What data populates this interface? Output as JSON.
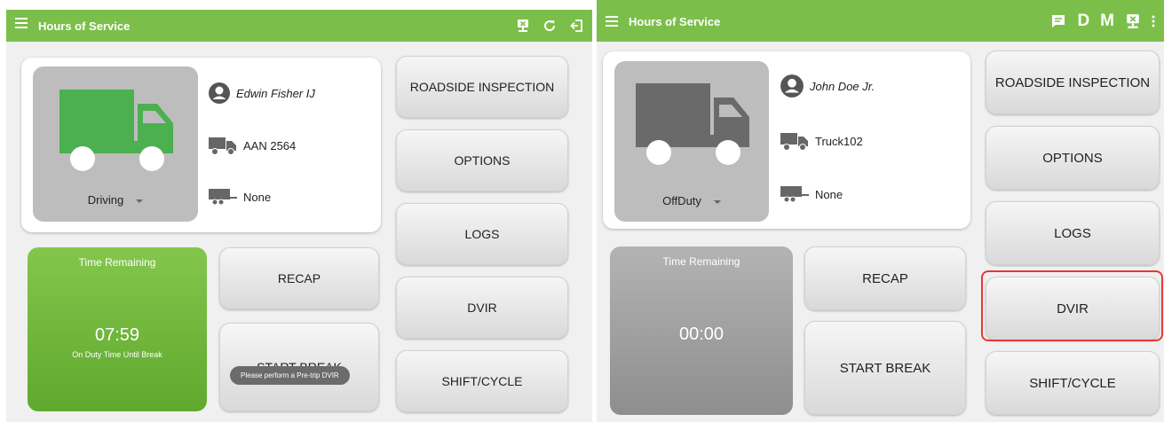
{
  "left": {
    "app_title": "Hours of Service",
    "status": "Driving",
    "driver_name": "Edwin Fisher IJ",
    "vehicle": "AAN 2564",
    "trailer": "None",
    "time_remaining_label": "Time Remaining",
    "time_value": "07:59",
    "time_sub": "On Duty Time Until Break",
    "buttons": {
      "roadside": "ROADSIDE INSPECTION",
      "options": "OPTIONS",
      "logs": "LOGS",
      "dvir": "DVIR",
      "shift": "SHIFT/CYCLE",
      "recap": "RECAP",
      "start_break": "START BREAK"
    },
    "toast": "Please perform a Pre-trip DVIR",
    "icons": [
      "menu-icon",
      "monitor-x-icon",
      "refresh-icon",
      "logout-icon"
    ],
    "colors": {
      "appbar": "#7bbf4a",
      "truck": "#4caf50",
      "timer": "#7cbf43"
    }
  },
  "right": {
    "app_title": "Hours of Service",
    "status": "OffDuty",
    "driver_name": "John Doe Jr.",
    "vehicle": "Truck102",
    "trailer": "None",
    "time_remaining_label": "Time Remaining",
    "time_value": "00:00",
    "toolbar": {
      "d_label": "D",
      "m_label": "M"
    },
    "buttons": {
      "roadside": "ROADSIDE INSPECTION",
      "options": "OPTIONS",
      "logs": "LOGS",
      "dvir": "DVIR",
      "shift": "SHIFT/CYCLE",
      "recap": "RECAP",
      "start_break": "START BREAK"
    },
    "icons": [
      "menu-icon",
      "message-icon",
      "monitor-x-icon",
      "overflow-menu-icon"
    ],
    "colors": {
      "appbar": "#7bbf4a",
      "truck": "#6a6a6a",
      "timer": "#a8a8a8",
      "highlight": "#e53935"
    }
  }
}
